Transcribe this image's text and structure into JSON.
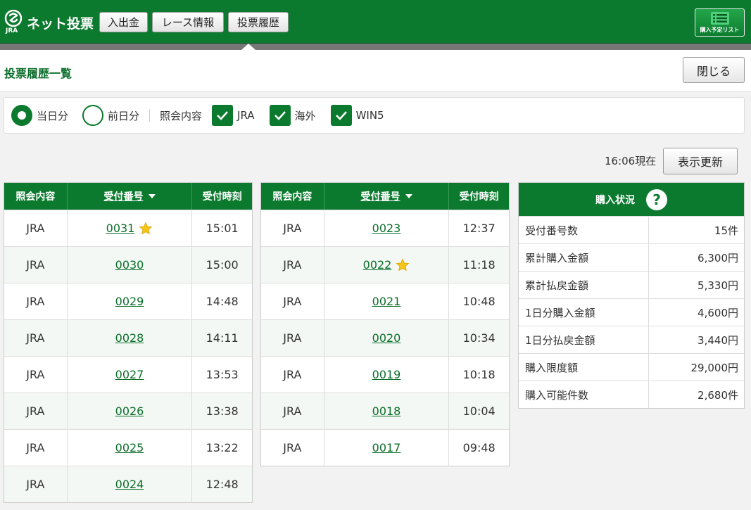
{
  "header": {
    "logo_sub": "JRA",
    "logo_text": "ネット投票",
    "nav": [
      "入出金",
      "レース情報",
      "投票履歴"
    ],
    "plan_button": "購入予定リスト"
  },
  "title_bar": {
    "title": "投票履歴一覧",
    "close_label": "閉じる"
  },
  "filters": {
    "radios": [
      {
        "label": "当日分",
        "selected": true
      },
      {
        "label": "前日分",
        "selected": false
      }
    ],
    "inquiry_label": "照会内容",
    "checks": [
      {
        "label": "JRA",
        "checked": true
      },
      {
        "label": "海外",
        "checked": true
      },
      {
        "label": "WIN5",
        "checked": true
      }
    ]
  },
  "refresh": {
    "as_of": "16:06現在",
    "button": "表示更新"
  },
  "table_headers": {
    "col1": "照会内容",
    "col2": "受付番号",
    "col3": "受付時刻"
  },
  "left_rows": [
    {
      "type": "JRA",
      "num": "0031",
      "time": "15:01",
      "star": true
    },
    {
      "type": "JRA",
      "num": "0030",
      "time": "15:00",
      "star": false
    },
    {
      "type": "JRA",
      "num": "0029",
      "time": "14:48",
      "star": false
    },
    {
      "type": "JRA",
      "num": "0028",
      "time": "14:11",
      "star": false
    },
    {
      "type": "JRA",
      "num": "0027",
      "time": "13:53",
      "star": false
    },
    {
      "type": "JRA",
      "num": "0026",
      "time": "13:38",
      "star": false
    },
    {
      "type": "JRA",
      "num": "0025",
      "time": "13:22",
      "star": false
    },
    {
      "type": "JRA",
      "num": "0024",
      "time": "12:48",
      "star": false
    }
  ],
  "right_rows": [
    {
      "type": "JRA",
      "num": "0023",
      "time": "12:37",
      "star": false
    },
    {
      "type": "JRA",
      "num": "0022",
      "time": "11:18",
      "star": true
    },
    {
      "type": "JRA",
      "num": "0021",
      "time": "10:48",
      "star": false
    },
    {
      "type": "JRA",
      "num": "0020",
      "time": "10:34",
      "star": false
    },
    {
      "type": "JRA",
      "num": "0019",
      "time": "10:18",
      "star": false
    },
    {
      "type": "JRA",
      "num": "0018",
      "time": "10:04",
      "star": false
    },
    {
      "type": "JRA",
      "num": "0017",
      "time": "09:48",
      "star": false
    }
  ],
  "summary": {
    "title": "購入状況",
    "help": "?",
    "rows": [
      {
        "label": "受付番号数",
        "value": "15件"
      },
      {
        "label": "累計購入金額",
        "value": "6,300円"
      },
      {
        "label": "累計払戻金額",
        "value": "5,330円"
      },
      {
        "label": "1日分購入金額",
        "value": "4,600円"
      },
      {
        "label": "1日分払戻金額",
        "value": "3,440円"
      },
      {
        "label": "購入限度額",
        "value": "29,000円"
      },
      {
        "label": "購入可能件数",
        "value": "2,680件"
      }
    ]
  },
  "colors": {
    "brand_green": "#0b7a2e",
    "star": "#f5c518"
  }
}
